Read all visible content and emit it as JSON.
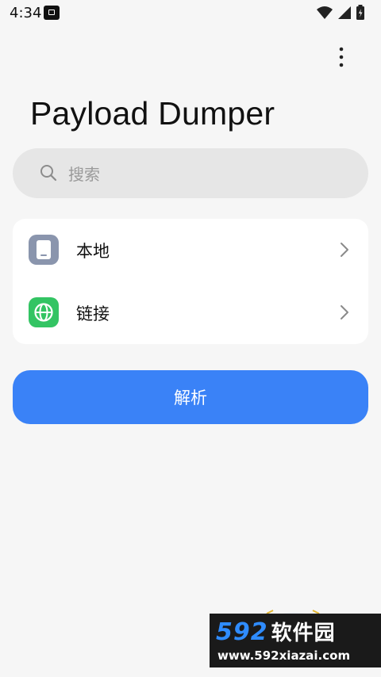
{
  "status_bar": {
    "time": "4:34"
  },
  "app": {
    "title": "Payload Dumper"
  },
  "search": {
    "placeholder": "搜索",
    "value": ""
  },
  "sources": [
    {
      "label": "本地",
      "icon": "phone-icon",
      "color": "#8a95ad"
    },
    {
      "label": "链接",
      "icon": "globe-icon",
      "color": "#33c463"
    }
  ],
  "primary_action": {
    "label": "解析",
    "color": "#3a82f7"
  },
  "watermark": {
    "brand_number": "592",
    "brand_text": "软件园",
    "url": "www.592xiazai.com"
  }
}
